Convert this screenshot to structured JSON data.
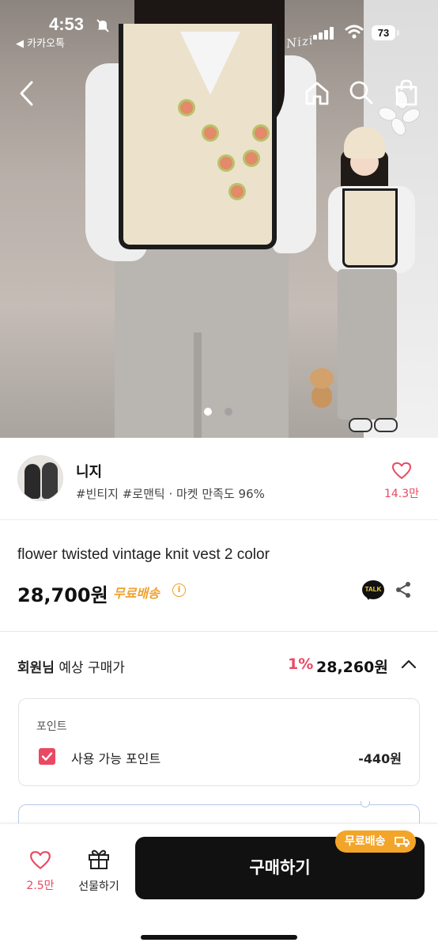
{
  "status_bar": {
    "time": "4:53",
    "back_app": "◀ 카카오톡",
    "battery": "73"
  },
  "hero": {
    "watermark": "Nizi",
    "page_indicator": {
      "total": 2,
      "current": 1
    },
    "colors": {
      "dot_active": "#ffffff",
      "dot_inactive": "#9a9a9a"
    }
  },
  "nav": {
    "icons": [
      "back-chevron-icon",
      "home-icon",
      "search-icon",
      "shopping-bag-icon"
    ]
  },
  "shop": {
    "name": "니지",
    "tags": "#빈티지 #로맨틱 · 마켓 만족도 96%",
    "like_count": "14.3만"
  },
  "product": {
    "title": "flower twisted vintage knit vest 2 color",
    "price": "28,700원",
    "free_shipping": "무료배송",
    "info_icon": "i",
    "talk_label": "TALK"
  },
  "member_price": {
    "label_bold": "회원님",
    "label_rest": " 예상 구매가",
    "discount": "1%",
    "price": "28,260원"
  },
  "points": {
    "title": "포인트",
    "label": "사용 가능 포인트",
    "value": "-440원",
    "checked": true
  },
  "bottom_bar": {
    "like_count": "2.5만",
    "gift_label": "선물하기",
    "buy_label": "구매하기",
    "ship_badge": "무료배송"
  },
  "colors": {
    "accent_pink": "#ea4963",
    "accent_orange": "#f0a12e",
    "buy_button": "#111111"
  }
}
